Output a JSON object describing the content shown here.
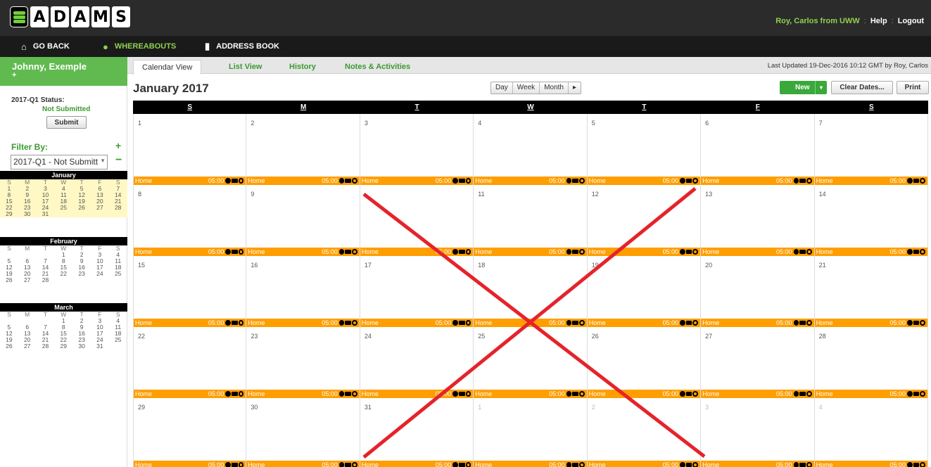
{
  "app": {
    "logo_letters": [
      "A",
      "D",
      "A",
      "M",
      "S"
    ],
    "user_name": "Roy, Carlos from UWW",
    "help_label": "Help",
    "logout_label": "Logout"
  },
  "nav": {
    "go_back": "GO BACK",
    "whereabouts": "WHEREABOUTS",
    "address_book": "ADDRESS BOOK"
  },
  "sidebar": {
    "athlete_name": "Johnny, Exemple",
    "athlete_plus": "+",
    "status_label": "2017-Q1 Status:",
    "status_value": "Not Submitted",
    "submit_label": "Submit",
    "filter_label": "Filter By:",
    "filter_add": "+",
    "filter_remove": "−",
    "filter_value": "2017-Q1 - Not Submitt",
    "mini_calendars": [
      {
        "month": "January",
        "dow": [
          "S",
          "M",
          "T",
          "W",
          "T",
          "F",
          "S"
        ],
        "rows": [
          [
            "1",
            "2",
            "3",
            "4",
            "5",
            "6",
            "7"
          ],
          [
            "8",
            "9",
            "10",
            "11",
            "12",
            "13",
            "14"
          ],
          [
            "15",
            "16",
            "17",
            "18",
            "19",
            "20",
            "21"
          ],
          [
            "22",
            "23",
            "24",
            "25",
            "26",
            "27",
            "28"
          ],
          [
            "29",
            "30",
            "31",
            "",
            "",
            "",
            ""
          ]
        ]
      },
      {
        "month": "February",
        "dow": [
          "S",
          "M",
          "T",
          "W",
          "T",
          "F",
          "S"
        ],
        "rows": [
          [
            "",
            "",
            "",
            "1",
            "2",
            "3",
            "4"
          ],
          [
            "5",
            "6",
            "7",
            "8",
            "9",
            "10",
            "11"
          ],
          [
            "12",
            "13",
            "14",
            "15",
            "16",
            "17",
            "18"
          ],
          [
            "19",
            "20",
            "21",
            "22",
            "23",
            "24",
            "25"
          ],
          [
            "26",
            "27",
            "28",
            "",
            "",
            "",
            ""
          ]
        ]
      },
      {
        "month": "March",
        "dow": [
          "S",
          "M",
          "T",
          "W",
          "T",
          "F",
          "S"
        ],
        "rows": [
          [
            "",
            "",
            "",
            "1",
            "2",
            "3",
            "4"
          ],
          [
            "5",
            "6",
            "7",
            "8",
            "9",
            "10",
            "11"
          ],
          [
            "12",
            "13",
            "14",
            "15",
            "16",
            "17",
            "18"
          ],
          [
            "19",
            "20",
            "21",
            "22",
            "23",
            "24",
            "25"
          ],
          [
            "26",
            "27",
            "28",
            "29",
            "30",
            "31",
            ""
          ]
        ]
      }
    ]
  },
  "tabs": {
    "calendar_view": "Calendar View",
    "list_view": "List View",
    "history": "History",
    "notes": "Notes & Activities",
    "last_updated": "Last Updated 19-Dec-2016 10:12 GMT by Roy, Carlos"
  },
  "toolbar": {
    "month_title": "January 2017",
    "day": "Day",
    "week": "Week",
    "month": "Month",
    "next": "▸",
    "new": "New",
    "new_caret": "▾",
    "clear_dates": "Clear Dates...",
    "print": "Print"
  },
  "calendar": {
    "headers": [
      "S",
      "M",
      "T",
      "W",
      "T",
      "F",
      "S"
    ],
    "location_label": "Home",
    "time_label": "05:00",
    "weeks": [
      [
        {
          "d": "1",
          "o": false
        },
        {
          "d": "2",
          "o": false
        },
        {
          "d": "3",
          "o": false
        },
        {
          "d": "4",
          "o": false
        },
        {
          "d": "5",
          "o": false
        },
        {
          "d": "6",
          "o": false
        },
        {
          "d": "7",
          "o": false
        }
      ],
      [
        {
          "d": "8",
          "o": false
        },
        {
          "d": "9",
          "o": false
        },
        {
          "d": "",
          "o": false
        },
        {
          "d": "11",
          "o": false
        },
        {
          "d": "12",
          "o": false
        },
        {
          "d": "13",
          "o": false
        },
        {
          "d": "14",
          "o": false
        }
      ],
      [
        {
          "d": "15",
          "o": false
        },
        {
          "d": "16",
          "o": false
        },
        {
          "d": "17",
          "o": false
        },
        {
          "d": "18",
          "o": false
        },
        {
          "d": "19",
          "o": false
        },
        {
          "d": "20",
          "o": false
        },
        {
          "d": "21",
          "o": false
        }
      ],
      [
        {
          "d": "22",
          "o": false
        },
        {
          "d": "23",
          "o": false
        },
        {
          "d": "24",
          "o": false
        },
        {
          "d": "25",
          "o": false
        },
        {
          "d": "26",
          "o": false
        },
        {
          "d": "27",
          "o": false
        },
        {
          "d": "28",
          "o": false
        }
      ],
      [
        {
          "d": "29",
          "o": false
        },
        {
          "d": "30",
          "o": false
        },
        {
          "d": "31",
          "o": false
        },
        {
          "d": "1",
          "o": true
        },
        {
          "d": "2",
          "o": true
        },
        {
          "d": "3",
          "o": true
        },
        {
          "d": "4",
          "o": true
        }
      ]
    ]
  },
  "colors": {
    "accent_green": "#61ba50",
    "location_orange": "#ff9e00",
    "cross_red": "#e5232a"
  }
}
